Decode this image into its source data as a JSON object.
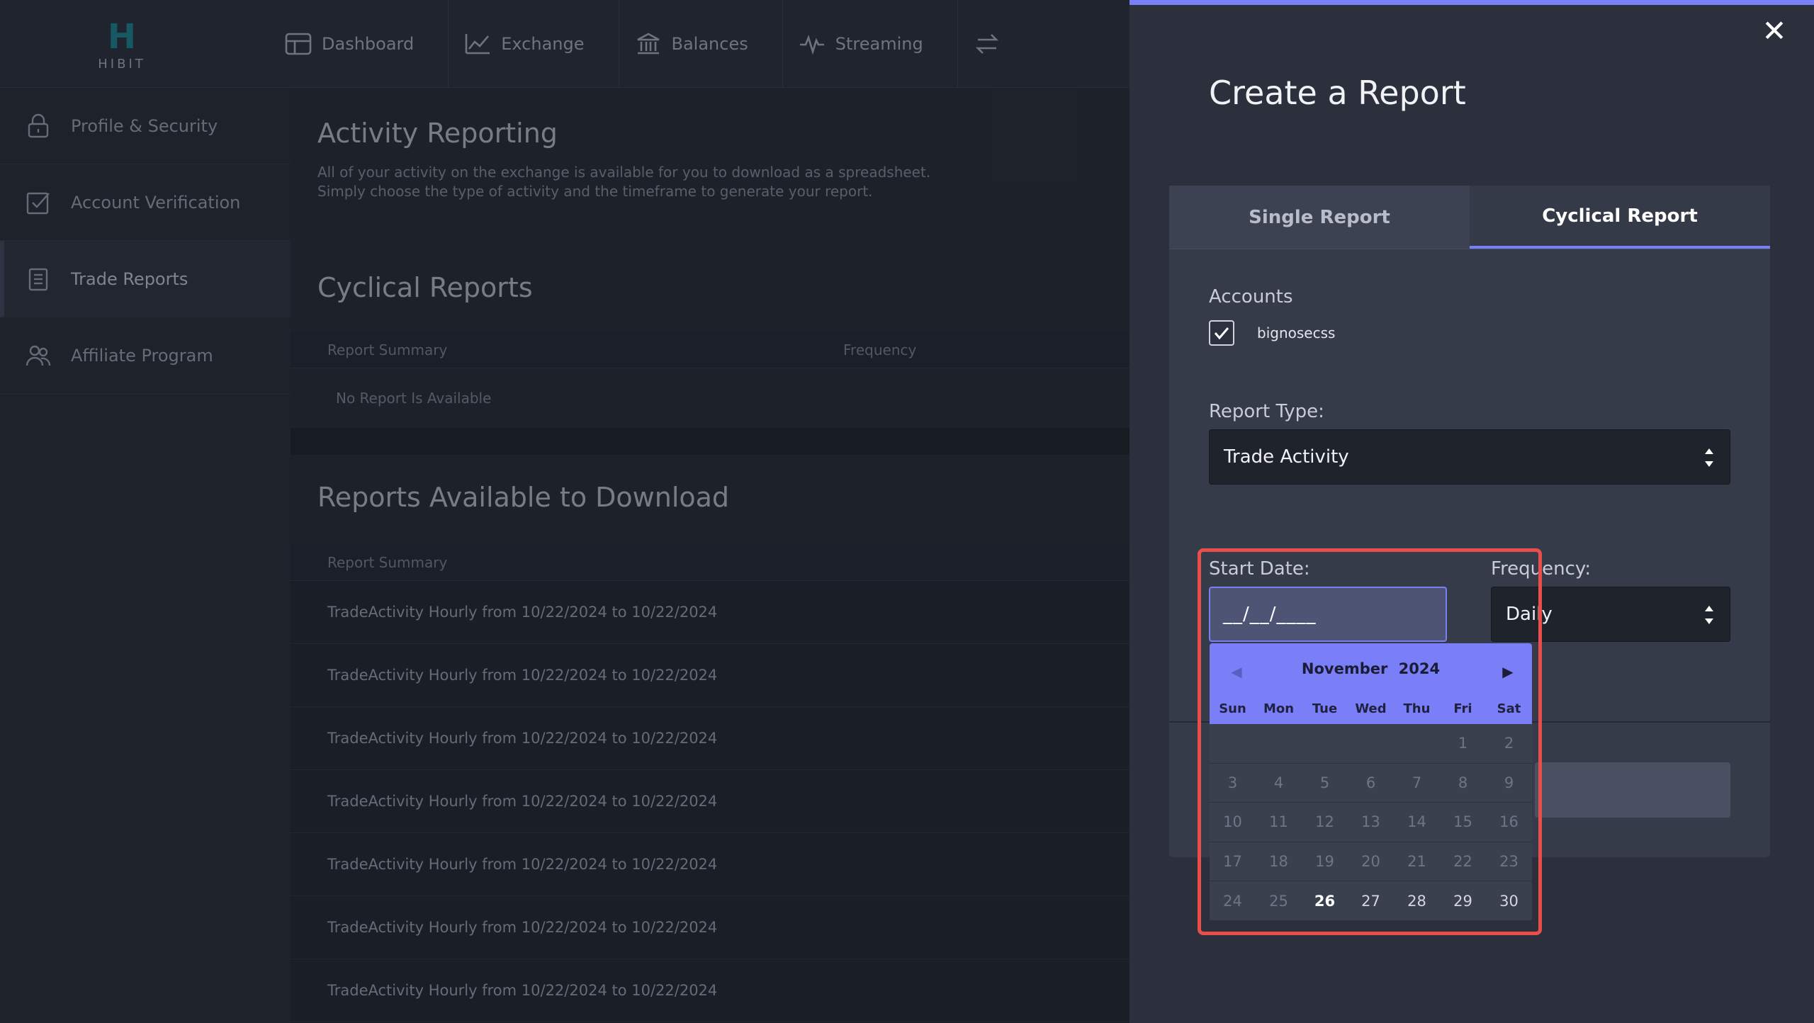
{
  "brand": {
    "logo_mark": "H",
    "logo_text": "HIBIT"
  },
  "nav": [
    {
      "label": "Dashboard",
      "icon": "dashboard-icon"
    },
    {
      "label": "Exchange",
      "icon": "chart-line-icon"
    },
    {
      "label": "Balances",
      "icon": "bank-icon"
    },
    {
      "label": "Streaming",
      "icon": "pulse-icon"
    }
  ],
  "sidebar": {
    "items": [
      {
        "label": "Profile & Security",
        "icon": "lock-icon"
      },
      {
        "label": "Account Verification",
        "icon": "checkbox-icon"
      },
      {
        "label": "Trade Reports",
        "icon": "clipboard-icon",
        "active": true
      },
      {
        "label": "Affiliate Program",
        "icon": "users-icon"
      }
    ]
  },
  "main": {
    "title": "Activity Reporting",
    "description_line1": "All of your activity on the exchange is available for you to download as a spreadsheet.",
    "description_line2": "Simply choose the type of activity and the timeframe to generate your report.",
    "cyclical": {
      "title": "Cyclical Reports",
      "col_summary": "Report Summary",
      "col_frequency": "Frequency",
      "empty": "No Report Is Available"
    },
    "downloads": {
      "title": "Reports Available to Download",
      "col_summary": "Report Summary",
      "rows": [
        "TradeActivity Hourly from 10/22/2024 to 10/22/2024",
        "TradeActivity Hourly from 10/22/2024 to 10/22/2024",
        "TradeActivity Hourly from 10/22/2024 to 10/22/2024",
        "TradeActivity Hourly from 10/22/2024 to 10/22/2024",
        "TradeActivity Hourly from 10/22/2024 to 10/22/2024",
        "TradeActivity Hourly from 10/22/2024 to 10/22/2024",
        "TradeActivity Hourly from 10/22/2024 to 10/22/2024"
      ]
    }
  },
  "modal": {
    "title": "Create a Report",
    "close": "✕",
    "tabs": {
      "single": "Single Report",
      "cyclical": "Cyclical Report",
      "active": "cyclical"
    },
    "accounts_label": "Accounts",
    "account_name": "bignosecss",
    "account_checked": true,
    "report_type_label": "Report Type:",
    "report_type_value": "Trade Activity",
    "start_date_label": "Start Date:",
    "start_date_value": "__/__/____",
    "frequency_label": "Frequency:",
    "frequency_value": "Daily"
  },
  "calendar": {
    "month": "November",
    "year": "2024",
    "weekdays": [
      "Sun",
      "Mon",
      "Tue",
      "Wed",
      "Thu",
      "Fri",
      "Sat"
    ],
    "weeks": [
      [
        "",
        "",
        "",
        "",
        "",
        "1",
        "2"
      ],
      [
        "3",
        "4",
        "5",
        "6",
        "7",
        "8",
        "9"
      ],
      [
        "10",
        "11",
        "12",
        "13",
        "14",
        "15",
        "16"
      ],
      [
        "17",
        "18",
        "19",
        "20",
        "21",
        "22",
        "23"
      ],
      [
        "24",
        "25",
        "26",
        "27",
        "28",
        "29",
        "30"
      ]
    ],
    "today": "26",
    "first_selectable": "26"
  },
  "colors": {
    "accent": "#7b7ff7",
    "highlight": "#ea4e4b",
    "panel_bg": "#2b303c"
  }
}
